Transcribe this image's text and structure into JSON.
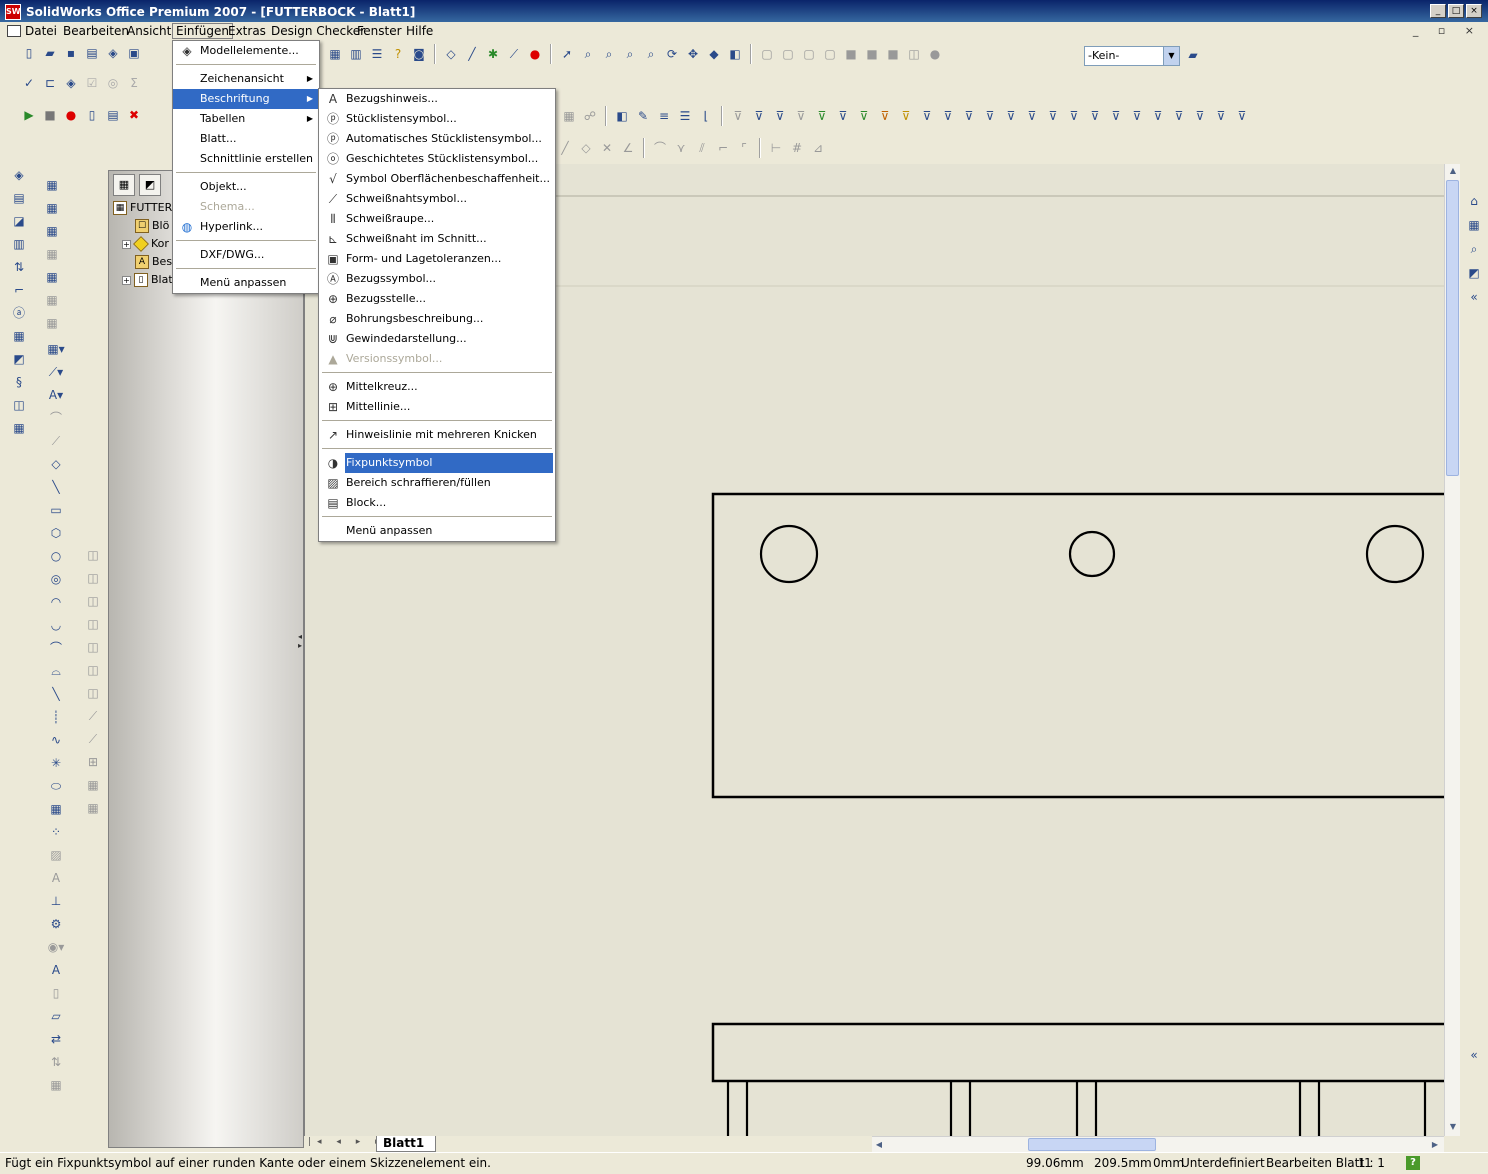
{
  "window": {
    "title": "SolidWorks Office Premium 2007 - [FUTTERBOCK - Blatt1]",
    "app_icon_text": "SW",
    "minimize": "_",
    "maximize": "□",
    "close": "×"
  },
  "menubar": {
    "items": [
      "Datei",
      "Bearbeiten",
      "Ansicht",
      "Einfügen",
      "Extras",
      "Design Checker",
      "Fenster",
      "Hilfe"
    ],
    "active": "Einfügen"
  },
  "toolbar": {
    "layer_combo_value": "-Kein-"
  },
  "einfuegen_menu": {
    "items": [
      {
        "label": "Modellelemente...",
        "icon": "model-items-icon"
      },
      {
        "sep": true
      },
      {
        "label": "Zeichenansicht",
        "submenu": true
      },
      {
        "label": "Beschriftung",
        "submenu": true,
        "highlighted": true
      },
      {
        "label": "Tabellen",
        "submenu": true
      },
      {
        "label": "Blatt..."
      },
      {
        "label": "Schnittlinie erstellen"
      },
      {
        "sep": true
      },
      {
        "label": "Objekt..."
      },
      {
        "label": "Schema...",
        "disabled": true
      },
      {
        "label": "Hyperlink...",
        "icon": "globe-icon"
      },
      {
        "sep": true
      },
      {
        "label": "DXF/DWG..."
      },
      {
        "sep": true
      },
      {
        "label": "Menü anpassen"
      }
    ]
  },
  "beschriftung_menu": {
    "items": [
      {
        "label": "Bezugshinweis...",
        "icon": "note-icon"
      },
      {
        "label": "Stücklistensymbol...",
        "icon": "balloon-icon"
      },
      {
        "label": "Automatisches Stücklistensymbol...",
        "icon": "auto-balloon-icon"
      },
      {
        "label": "Geschichtetes Stücklistensymbol...",
        "icon": "stacked-balloon-icon"
      },
      {
        "label": "Symbol Oberflächenbeschaffenheit...",
        "icon": "surface-finish-icon"
      },
      {
        "label": "Schweißnahtsymbol...",
        "icon": "weld-symbol-icon"
      },
      {
        "label": "Schweißraupe...",
        "icon": "weld-bead-icon"
      },
      {
        "label": "Schweißnaht im Schnitt...",
        "icon": "weld-section-icon"
      },
      {
        "label": "Form- und Lagetoleranzen...",
        "icon": "geometric-tolerance-icon"
      },
      {
        "label": "Bezugssymbol...",
        "icon": "datum-feature-icon"
      },
      {
        "label": "Bezugsstelle...",
        "icon": "datum-target-icon"
      },
      {
        "label": "Bohrungsbeschreibung...",
        "icon": "hole-callout-icon"
      },
      {
        "label": "Gewindedarstellung...",
        "icon": "cosmetic-thread-icon"
      },
      {
        "label": "Versionssymbol...",
        "icon": "revision-symbol-icon",
        "disabled": true
      },
      {
        "sep": true
      },
      {
        "label": "Mittelkreuz...",
        "icon": "center-mark-icon"
      },
      {
        "label": "Mittellinie...",
        "icon": "centerline-icon"
      },
      {
        "sep": true
      },
      {
        "label": "Hinweislinie mit mehreren Knicken",
        "icon": "multi-jog-leader-icon"
      },
      {
        "sep": true
      },
      {
        "label": "Fixpunktsymbol",
        "icon": "center-of-mass-icon",
        "highlighted": true
      },
      {
        "label": "Bereich schraffieren/füllen",
        "icon": "area-hatch-icon"
      },
      {
        "label": "Block...",
        "icon": "block-icon"
      },
      {
        "sep": true
      },
      {
        "label": "Menü anpassen"
      }
    ]
  },
  "feature_manager": {
    "tree": [
      {
        "label": "FUTTER",
        "icon": "drawing-icon"
      },
      {
        "label": "Blö",
        "icon": "annotations-icon"
      },
      {
        "label": "Kor",
        "icon": "sheet-format-icon",
        "expandable": true
      },
      {
        "label": "Bes",
        "icon": "annotation-A-icon"
      },
      {
        "label": "Blat",
        "icon": "sheet-icon",
        "expandable": true
      }
    ]
  },
  "sheet_tabs": [
    "Blatt1"
  ],
  "statusbar": {
    "message": "Fügt ein Fixpunktsymbol auf einer runden Kante oder einem Skizzenelement ein.",
    "x": "99.06mm",
    "y": "209.5mm",
    "z": "0mm",
    "state": "Unterdefiniert",
    "mode": "Bearbeiten Blatt1",
    "scale": "1 : 1",
    "help": "?"
  }
}
